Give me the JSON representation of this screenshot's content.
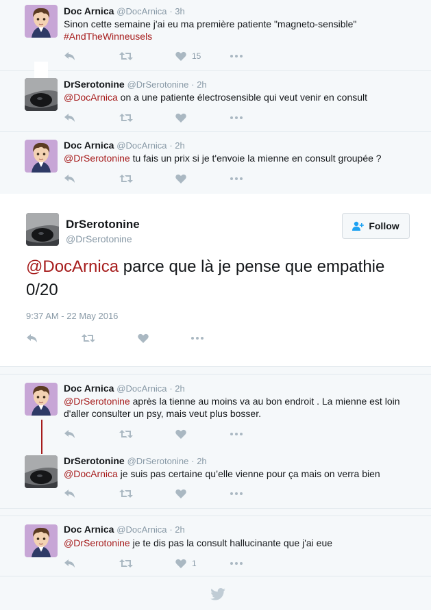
{
  "tweets_top": [
    {
      "name": "Doc Arnica",
      "handle": "@DocArnica",
      "time": "· 3h",
      "text": "Sinon cette semaine j'ai eu ma première patiente \"magneto-sensible\"",
      "hashtag": "#AndTheWinneusels",
      "likes": "15",
      "avatar": "manga-avatar"
    },
    {
      "name": "DrSerotonine",
      "handle": "@DrSerotonine",
      "time": "· 2h",
      "mention": "@DocArnica",
      "text": " on a une patiente électrosensible qui veut venir en consult",
      "likes": "",
      "avatar": "horse-eye-avatar"
    },
    {
      "name": "Doc Arnica",
      "handle": "@DocArnica",
      "time": "· 2h",
      "mention": "@DrSerotonine",
      "text": " tu fais un prix si je t'envoie la mienne en consult groupée ?",
      "likes": "",
      "avatar": "manga-avatar"
    }
  ],
  "focus": {
    "name": "DrSerotonine",
    "handle": "@DrSerotonine",
    "follow_label": "Follow",
    "mention": "@DocArnica",
    "text": " parce que là je pense que empathie 0/20",
    "date": "9:37 AM - 22 May 2016"
  },
  "replies": [
    {
      "name": "Doc Arnica",
      "handle": "@DocArnica",
      "time": "· 2h",
      "mention": "@DrSerotonine",
      "text": " après la tienne au moins va au bon endroit . La mienne est loin d'aller consulter un psy, mais veut plus bosser.",
      "likes": ""
    },
    {
      "name": "DrSerotonine",
      "handle": "@DrSerotonine",
      "time": "· 2h",
      "mention": "@DocArnica",
      "text": " je suis pas certaine qu’elle vienne pour ça mais on verra bien",
      "likes": ""
    },
    {
      "name": "Doc Arnica",
      "handle": "@DocArnica",
      "time": "· 2h",
      "mention": "@DrSerotonine",
      "text": " je te dis pas la consult hallucinante que j'ai eue",
      "likes": "1"
    }
  ],
  "icons": [
    "reply-icon",
    "retweet-icon",
    "like-icon",
    "more-icon",
    "follow-person-icon",
    "twitter-bird-icon"
  ],
  "colors": {
    "mention": "#a61c1c",
    "meta": "#8899a6",
    "background": "#f5f8fa"
  }
}
